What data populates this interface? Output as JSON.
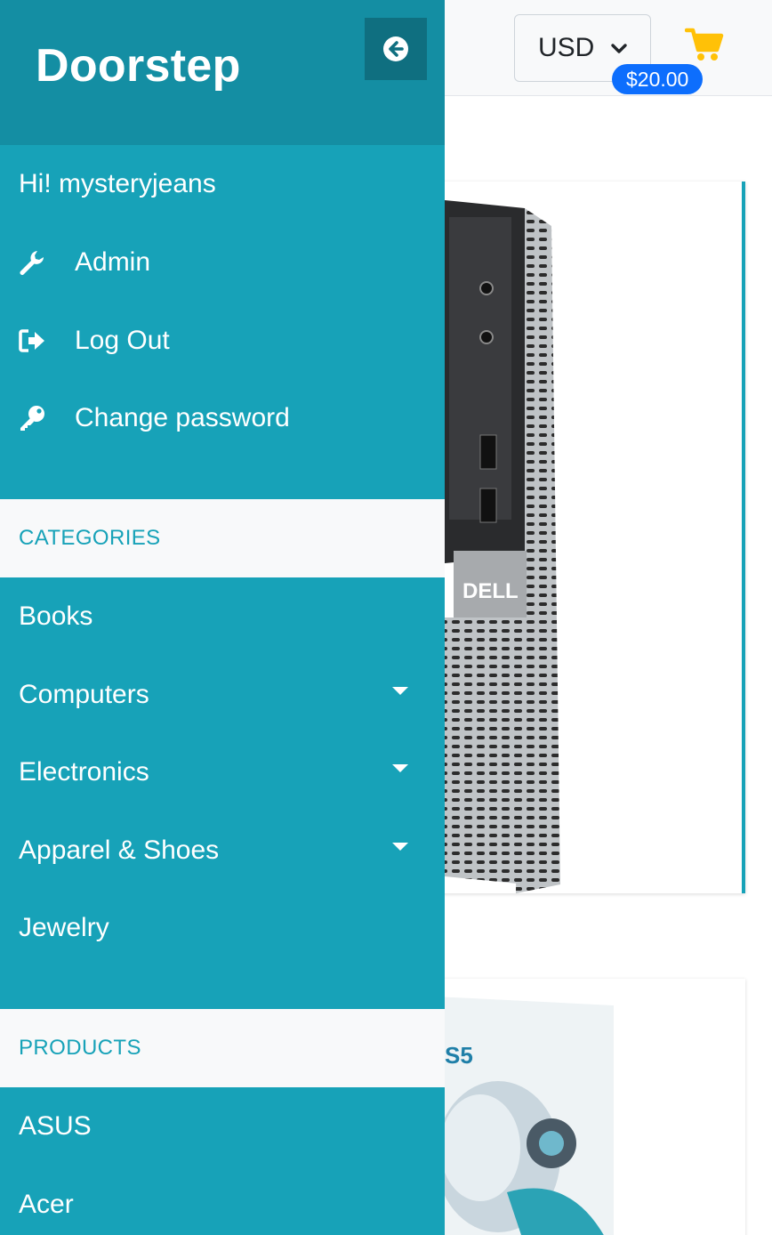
{
  "app": {
    "brand": "Doorstep"
  },
  "header": {
    "currency": {
      "selected": "USD"
    },
    "cart": {
      "total": "$20.00",
      "icon": "cart-icon",
      "icon_color": "#ffc107"
    }
  },
  "sidebar": {
    "greeting": "Hi! mysteryjeans",
    "account_links": [
      {
        "label": "Admin",
        "icon": "wrench-icon"
      },
      {
        "label": "Log Out",
        "icon": "sign-out-icon"
      },
      {
        "label": "Change password",
        "icon": "key-icon"
      }
    ],
    "categories_heading": "CATEGORIES",
    "categories": [
      {
        "label": "Books",
        "has_submenu": false
      },
      {
        "label": "Computers",
        "has_submenu": true
      },
      {
        "label": "Electronics",
        "has_submenu": true
      },
      {
        "label": "Apparel & Shoes",
        "has_submenu": true
      },
      {
        "label": "Jewelry",
        "has_submenu": false
      }
    ],
    "products_heading": "PRODUCTS",
    "products": [
      {
        "label": "ASUS"
      },
      {
        "label": "Acer"
      }
    ]
  },
  "colors": {
    "sidebar_bg": "#17a2b8",
    "sidebar_header_bg": "#148ea3",
    "badge_bg": "#0d6efd",
    "cart_icon": "#ffc107"
  }
}
